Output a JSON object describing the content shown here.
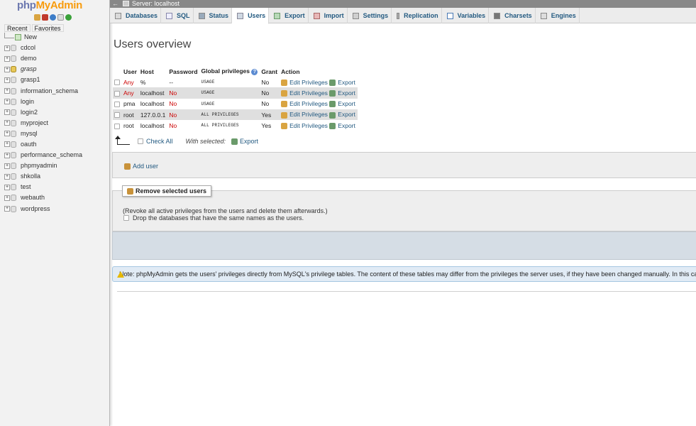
{
  "app": {
    "logo_php": "php",
    "logo_my": "MyAdmin"
  },
  "navigation": {
    "tabs": [
      "Recent",
      "Favorites"
    ],
    "new_label": "New",
    "databases": [
      "cdcol",
      "demo",
      "grasp",
      "grasp1",
      "information_schema",
      "login",
      "login2",
      "myproject",
      "mysql",
      "oauth",
      "performance_schema",
      "phpmyadmin",
      "shkolla",
      "test",
      "webauth",
      "wordpress"
    ]
  },
  "server_bar": {
    "title": "Server: localhost"
  },
  "menu": {
    "tabs": [
      "Databases",
      "SQL",
      "Status",
      "Users",
      "Export",
      "Import",
      "Settings",
      "Replication",
      "Variables",
      "Charsets",
      "Engines"
    ],
    "active": "Users"
  },
  "page": {
    "title": "Users overview"
  },
  "users_table": {
    "headers": {
      "user": "User",
      "host": "Host",
      "password": "Password",
      "global_privileges": "Global privileges",
      "grant": "Grant",
      "action": "Action"
    },
    "help_glyph": "?",
    "rows": [
      {
        "user": "Any",
        "host": "%",
        "password": "--",
        "privileges": "USAGE",
        "grant": "No",
        "edit": "Edit Privileges",
        "export": "Export"
      },
      {
        "user": "Any",
        "host": "localhost",
        "password": "No",
        "privileges": "USAGE",
        "grant": "No",
        "edit": "Edit Privileges",
        "export": "Export"
      },
      {
        "user": "pma",
        "host": "localhost",
        "password": "No",
        "privileges": "USAGE",
        "grant": "No",
        "edit": "Edit Privileges",
        "export": "Export"
      },
      {
        "user": "root",
        "host": "127.0.0.1",
        "password": "No",
        "privileges": "ALL PRIVILEGES",
        "grant": "Yes",
        "edit": "Edit Privileges",
        "export": "Export"
      },
      {
        "user": "root",
        "host": "localhost",
        "password": "No",
        "privileges": "ALL PRIVILEGES",
        "grant": "Yes",
        "edit": "Edit Privileges",
        "export": "Export"
      }
    ]
  },
  "bulk": {
    "check_all": "Check All",
    "with_selected": "With selected:",
    "export": "Export"
  },
  "add_user": {
    "label": "Add user"
  },
  "remove_users": {
    "legend": "Remove selected users",
    "note": "(Revoke all active privileges from the users and delete them afterwards.)",
    "drop_db_label": "Drop the databases that have the same names as the users."
  },
  "notice": {
    "text": "Note: phpMyAdmin gets the users' privileges directly from MySQL's privilege tables. The content of these tables may differ from the privileges the server uses, if they have been changed manually. In this case, you sh"
  },
  "colors": {
    "link": "#235a81",
    "danger": "#cc0000",
    "logo_blue": "#6c78af",
    "logo_orange": "#f89c0e"
  }
}
